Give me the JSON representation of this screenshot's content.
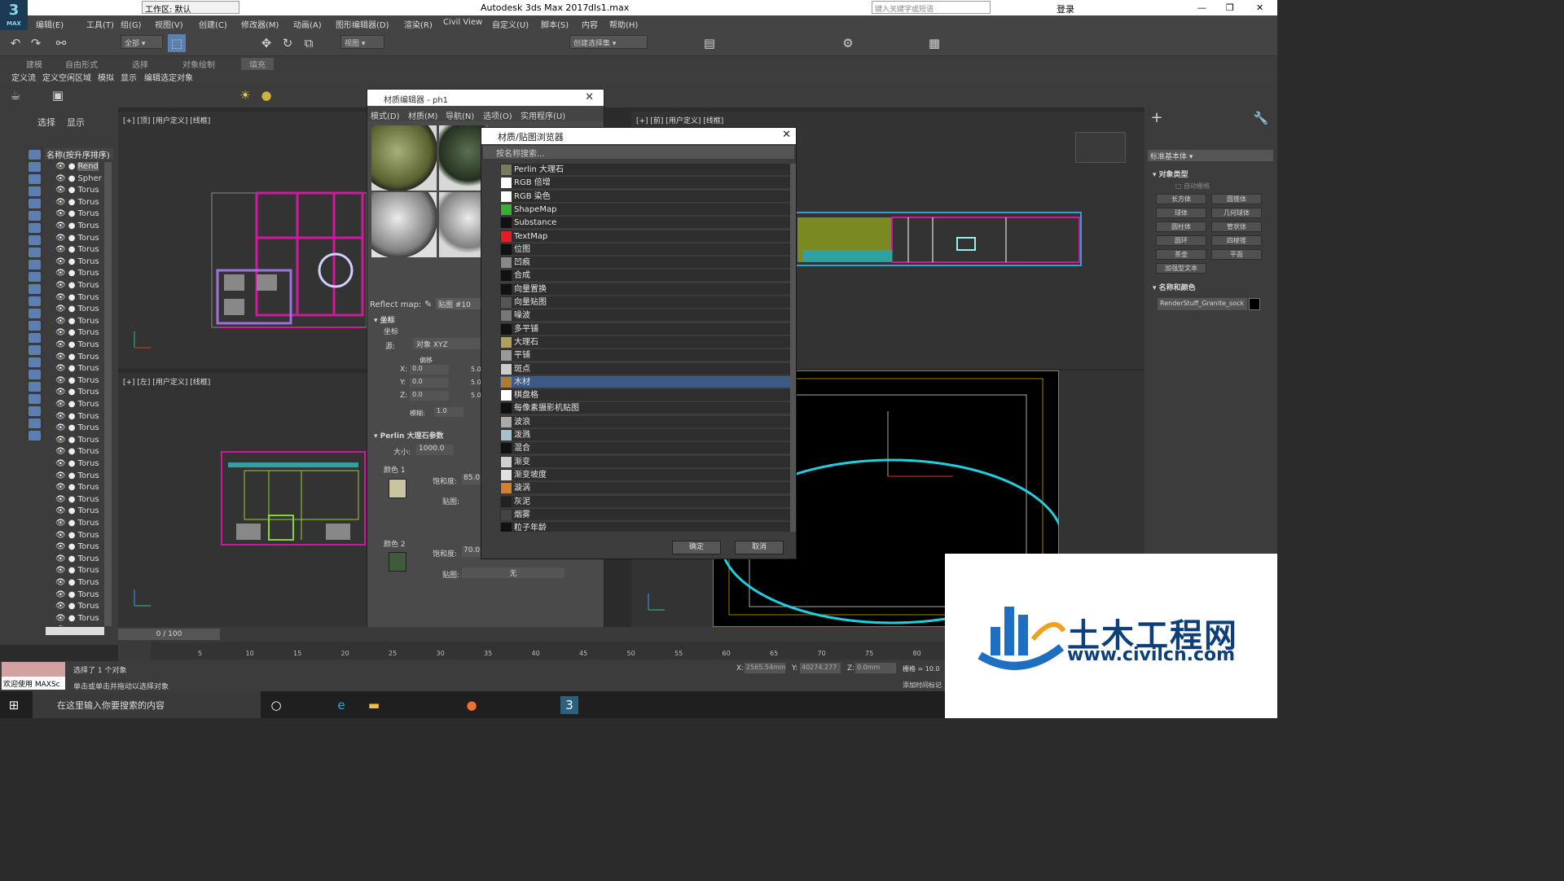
{
  "app": {
    "title": "Autodesk 3ds Max 2017",
    "file": "dls1.max",
    "workspace_label": "工作区: 默认",
    "search_placeholder": "键入关键字或短语",
    "login": "登录",
    "logo_text": "3",
    "logo_sub": "MAX"
  },
  "menu": [
    "编辑(E)",
    "工具(T)",
    "组(G)",
    "视图(V)",
    "创建(C)",
    "修改器(M)",
    "动画(A)",
    "图形编辑器(D)",
    "渲染(R)",
    "Civil View",
    "自定义(U)",
    "脚本(S)",
    "内容",
    "帮助(H)"
  ],
  "toolbar": {
    "selection_filter": "全部",
    "ref_coord": "视图",
    "named_selection": "创建选择集"
  },
  "ribbon": {
    "tabs": [
      "建模",
      "自由形式",
      "选择",
      "对象绘制",
      "填充"
    ],
    "subtabs": [
      "定义流",
      "定义空闲区域",
      "模拟",
      "显示",
      "编辑选定对象"
    ]
  },
  "scene_explorer": {
    "tabs": [
      "选择",
      "显示"
    ],
    "header": "名称(按升序排序)",
    "rows": [
      "Rend",
      "Spher",
      "Torus",
      "Torus",
      "Torus",
      "Torus",
      "Torus",
      "Torus",
      "Torus",
      "Torus",
      "Torus",
      "Torus",
      "Torus",
      "Torus",
      "Torus",
      "Torus",
      "Torus",
      "Torus",
      "Torus",
      "Torus",
      "Torus",
      "Torus",
      "Torus",
      "Torus",
      "Torus",
      "Torus",
      "Torus",
      "Torus",
      "Torus",
      "Torus",
      "Torus",
      "Torus",
      "Torus",
      "Torus",
      "Torus",
      "Torus",
      "Torus",
      "Torus",
      "Torus",
      "Torus",
      "Torus"
    ]
  },
  "viewports": {
    "top": "[+] [顶] [用户定义] [线框]",
    "left": "[+] [左] [用户定义] [线框]",
    "front": "[+] [前] [用户定义] [线框]"
  },
  "material_editor": {
    "title": "材质编辑器 - ph1",
    "menu": [
      "模式(D)",
      "材质(M)",
      "导航(N)",
      "选项(O)",
      "实用程序(U)"
    ],
    "reflect_label": "Reflect map:",
    "map_name": "贴图 #10",
    "coords_section": "坐标",
    "coords_sub": "坐标",
    "source_label": "源:",
    "source_value": "对象 XYZ",
    "offset_label": "偏移",
    "xyz": [
      {
        "axis": "X:",
        "value": "0.0",
        "tile": "5.0"
      },
      {
        "axis": "Y:",
        "value": "0.0",
        "tile": "5.0"
      },
      {
        "axis": "Z:",
        "value": "0.0",
        "tile": "5.0"
      }
    ],
    "blur_label": "模糊:",
    "blur_value": "1.0",
    "perlin_section": "Perlin 大理石参数",
    "size_label": "大小:",
    "size_value": "1000.0",
    "color1_label": "颜色 1",
    "color2_label": "颜色 2",
    "sat_label": "饱和度:",
    "sat1": "85.0",
    "sat2": "70.0",
    "map_label": "贴图:",
    "none_label": "无",
    "color1": "#c9c5a0",
    "color2": "#3f5b3b"
  },
  "browser": {
    "title": "材质/贴图浏览器",
    "search": "按名称搜索...",
    "items": [
      {
        "name": "Perlin 大理石",
        "color": "#7a7a5a"
      },
      {
        "name": "RGB 倍增",
        "color": "#ffffff"
      },
      {
        "name": "RGB 染色",
        "color": "#ffffff"
      },
      {
        "name": "ShapeMap",
        "color": "#35b035"
      },
      {
        "name": "Substance",
        "color": "#111111"
      },
      {
        "name": "TextMap",
        "color": "#e02020"
      },
      {
        "name": "位图",
        "color": "#111111"
      },
      {
        "name": "凹痕",
        "color": "#888888"
      },
      {
        "name": "合成",
        "color": "#111111"
      },
      {
        "name": "向量置换",
        "color": "#111111"
      },
      {
        "name": "向量贴图",
        "color": "#555555"
      },
      {
        "name": "噪波",
        "color": "#777777"
      },
      {
        "name": "多平铺",
        "color": "#111111"
      },
      {
        "name": "大理石",
        "color": "#b0a060"
      },
      {
        "name": "平铺",
        "color": "#999999"
      },
      {
        "name": "斑点",
        "color": "#cccccc"
      },
      {
        "name": "木材",
        "color": "#b07a30"
      },
      {
        "name": "棋盘格",
        "color": "#ffffff"
      },
      {
        "name": "每像素摄影机贴图",
        "color": "#111111"
      },
      {
        "name": "波浪",
        "color": "#aaaaaa"
      },
      {
        "name": "泼溅",
        "color": "#a8c0c8"
      },
      {
        "name": "混合",
        "color": "#111111"
      },
      {
        "name": "渐变",
        "color": "#d0d0d0"
      },
      {
        "name": "渐变坡度",
        "color": "#e0e0e0"
      },
      {
        "name": "漩涡",
        "color": "#d08030"
      },
      {
        "name": "灰泥",
        "color": "#222222"
      },
      {
        "name": "烟雾",
        "color": "#444444"
      },
      {
        "name": "粒子年龄",
        "color": "#111111"
      }
    ],
    "selected_index": 16,
    "ok": "确定",
    "cancel": "取消"
  },
  "command_panel": {
    "dropdown": "标准基本体",
    "obj_type_header": "对象类型",
    "auto_grid": "自动栅格",
    "buttons": [
      "长方体",
      "圆锥体",
      "球体",
      "几何球体",
      "圆柱体",
      "管状体",
      "圆环",
      "四棱锥",
      "茶壶",
      "平面",
      "加强型文本"
    ],
    "name_color_header": "名称和颜色",
    "name_value": "RenderStuff_Granite_sock"
  },
  "timeline": {
    "frame": "0 / 100",
    "ticks": [
      "5",
      "10",
      "15",
      "20",
      "25",
      "30",
      "35",
      "40",
      "45",
      "50",
      "55",
      "60",
      "65",
      "70",
      "75",
      "80"
    ]
  },
  "status": {
    "welcome": "欢迎使用 MAXSc",
    "selected": "选择了 1 个对象",
    "hint": "单击或单击并拖动以选择对象",
    "x_label": "X:",
    "x_value": "2565.54mm",
    "y_label": "Y:",
    "y_value": "40274.277",
    "z_label": "Z:",
    "z_value": "0.0mm",
    "grid": "栅格 = 10.0",
    "add_time": "添加时间标记"
  },
  "taskbar": {
    "search": "在这里输入你要搜索的内容"
  },
  "watermark": {
    "cn": "土木工程网",
    "url": "www.civilcn.com"
  }
}
